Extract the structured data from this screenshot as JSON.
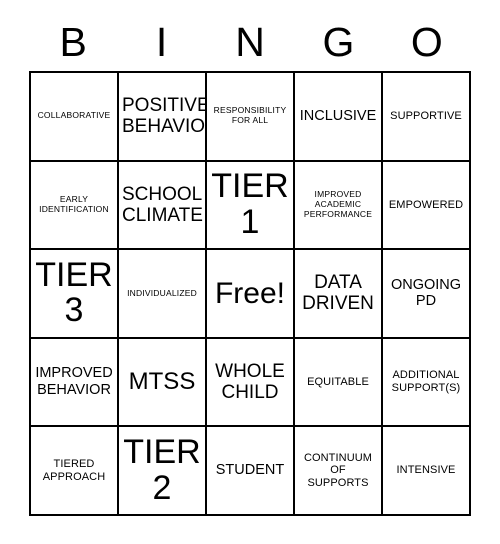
{
  "card": {
    "header_letters": [
      "B",
      "I",
      "N",
      "G",
      "O"
    ],
    "free_space_index": 12,
    "colors": {
      "background": "#ffffff",
      "border": "#000000",
      "text": "#000000"
    },
    "cells": [
      {
        "text": "COLLABORATIVE",
        "size": "xs"
      },
      {
        "text": "POSITIVE\nBEHAVIOR",
        "size": "l"
      },
      {
        "text": "RESPONSIBILITY\nFOR ALL",
        "size": "xs"
      },
      {
        "text": "INCLUSIVE",
        "size": "m"
      },
      {
        "text": "SUPPORTIVE",
        "size": "s"
      },
      {
        "text": "EARLY\nIDENTIFICATION",
        "size": "xs"
      },
      {
        "text": "SCHOOL\nCLIMATE",
        "size": "l"
      },
      {
        "text": "TIER\n1",
        "size": "tier"
      },
      {
        "text": "IMPROVED\nACADEMIC\nPERFORMANCE",
        "size": "xs"
      },
      {
        "text": "EMPOWERED",
        "size": "s"
      },
      {
        "text": "TIER\n3",
        "size": "tier"
      },
      {
        "text": "INDIVIDUALIZED",
        "size": "xs"
      },
      {
        "text": "Free!",
        "size": "free"
      },
      {
        "text": "DATA\nDRIVEN",
        "size": "l"
      },
      {
        "text": "ONGOING\nPD",
        "size": "m"
      },
      {
        "text": "IMPROVED\nBEHAVIOR",
        "size": "m"
      },
      {
        "text": "MTSS",
        "size": "xl"
      },
      {
        "text": "WHOLE\nCHILD",
        "size": "l"
      },
      {
        "text": "EQUITABLE",
        "size": "s"
      },
      {
        "text": "ADDITIONAL\nSUPPORT(S)",
        "size": "s"
      },
      {
        "text": "TIERED\nAPPROACH",
        "size": "s"
      },
      {
        "text": "TIER\n2",
        "size": "tier"
      },
      {
        "text": "STUDENT",
        "size": "m"
      },
      {
        "text": "CONTINUUM\nOF\nSUPPORTS",
        "size": "s"
      },
      {
        "text": "INTENSIVE",
        "size": "s"
      }
    ]
  }
}
